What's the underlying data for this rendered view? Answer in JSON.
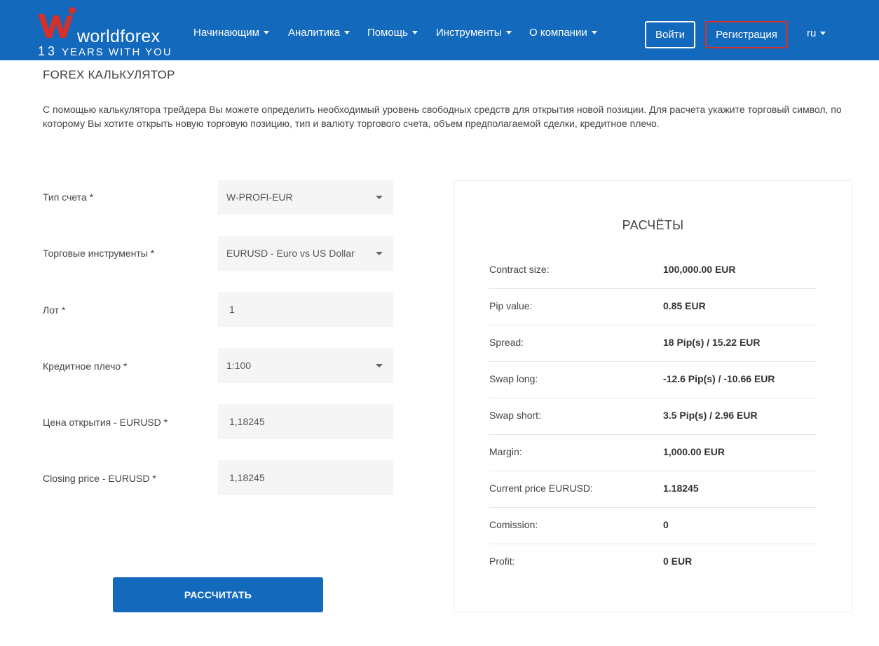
{
  "header": {
    "logo_name": "worldforex",
    "logo_tag_number": "13",
    "logo_tag_text": "YEARS WITH YOU",
    "brand_color": "#1369bc",
    "nav": [
      {
        "label": "Начинающим"
      },
      {
        "label": "Аналитика"
      },
      {
        "label": "Помощь"
      },
      {
        "label": "Инструменты"
      },
      {
        "label": "О компании"
      }
    ],
    "login_label": "Войти",
    "register_label": "Регистрация",
    "lang_label": "ru"
  },
  "page": {
    "title": "FOREX КАЛЬКУЛЯТОР",
    "intro": "С помощью калькулятора трейдера Вы можете определить необходимый уровень свободных средств для открытия новой позиции. Для расчета укажите торговый символ, по которому Вы хотите открыть новую торговую позицию, тип и валюту торгового счета, объем предполагаемой сделки, кредитное плечо."
  },
  "form": {
    "account_type": {
      "label": "Тип счета *",
      "value": "W-PROFI-EUR"
    },
    "instrument": {
      "label": "Торговые инструменты *",
      "value": "EURUSD - Euro vs US Dollar"
    },
    "lot": {
      "label": "Лот *",
      "value": "1"
    },
    "leverage": {
      "label": "Кредитное плечо *",
      "value": "1:100"
    },
    "open_price": {
      "label": "Цена открытия - EURUSD *",
      "value": "1,18245"
    },
    "close_price": {
      "label": "Closing price - EURUSD *",
      "value": "1,18245"
    },
    "submit_label": "РАССЧИТАТЬ"
  },
  "results": {
    "title": "РАСЧЁТЫ",
    "rows": [
      {
        "label": "Contract size:",
        "value": "100,000.00 EUR"
      },
      {
        "label": "Pip value:",
        "value": "0.85 EUR"
      },
      {
        "label": "Spread:",
        "value": "18 Pip(s) / 15.22 EUR"
      },
      {
        "label": "Swap long:",
        "value": "-12.6 Pip(s) / -10.66 EUR"
      },
      {
        "label": "Swap short:",
        "value": "3.5 Pip(s) / 2.96 EUR"
      },
      {
        "label": "Margin:",
        "value": "1,000.00 EUR"
      },
      {
        "label": "Current price EURUSD:",
        "value": "1.18245"
      },
      {
        "label": "Comission:",
        "value": "0"
      },
      {
        "label": "Profit:",
        "value": "0 EUR"
      }
    ]
  }
}
